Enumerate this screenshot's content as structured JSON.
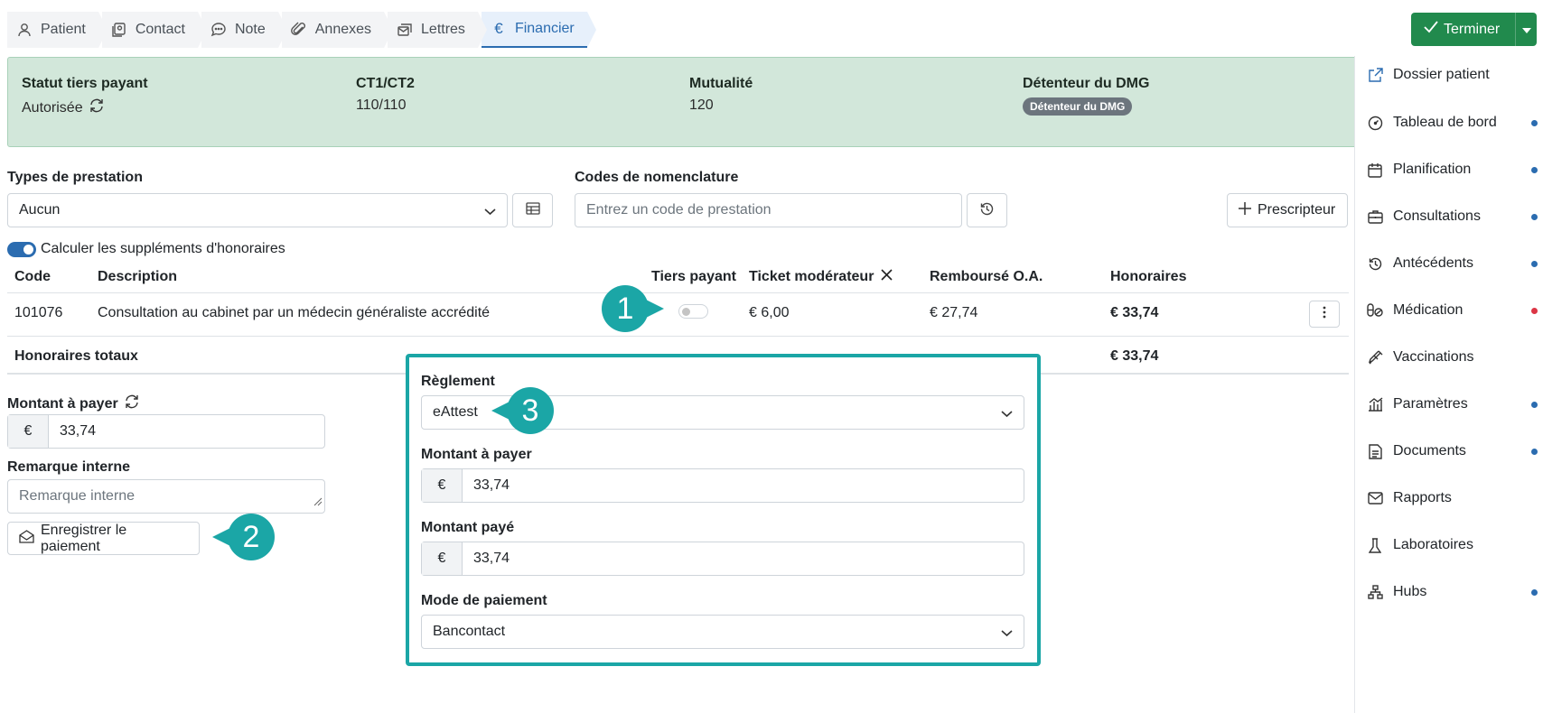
{
  "tabs": [
    {
      "label": "Patient",
      "icon": "user-icon"
    },
    {
      "label": "Contact",
      "icon": "contact-book-icon"
    },
    {
      "label": "Note",
      "icon": "chat-bubble-icon"
    },
    {
      "label": "Annexes",
      "icon": "paperclip-icon"
    },
    {
      "label": "Lettres",
      "icon": "envelopes-icon"
    },
    {
      "label": "Financier",
      "icon": "euro-icon",
      "active": true
    }
  ],
  "header": {
    "finish_label": "Terminer"
  },
  "status": {
    "tp_label": "Statut tiers payant",
    "tp_value": "Autorisée",
    "ct_label": "CT1/CT2",
    "ct_value": "110/110",
    "mut_label": "Mutualité",
    "mut_value": "120",
    "dmg_label": "Détenteur du DMG",
    "dmg_badge": "Détenteur du DMG"
  },
  "form": {
    "types_label": "Types de prestation",
    "types_value": "Aucun",
    "codes_label": "Codes de nomenclature",
    "codes_placeholder": "Entrez un code de prestation",
    "prescriber_label": "Prescripteur",
    "supplements_label": "Calculer les suppléments d'honoraires",
    "supplements_enabled": true
  },
  "table": {
    "headers": {
      "code": "Code",
      "description": "Description",
      "tp": "Tiers payant",
      "ticket": "Ticket modérateur",
      "rembourse": "Remboursé O.A.",
      "honoraires": "Honoraires"
    },
    "rows": [
      {
        "code": "101076",
        "description": "Consultation au cabinet par un médecin généraliste accrédité",
        "tiers_payant": false,
        "ticket": "€ 6,00",
        "rembourse": "€ 27,74",
        "honoraires": "€ 33,74"
      }
    ],
    "total_label": "Honoraires totaux",
    "total_value": "€ 33,74"
  },
  "payment_left": {
    "amount_label": "Montant à payer",
    "currency": "€",
    "amount_value": "33,74",
    "remark_label": "Remarque interne",
    "remark_placeholder": "Remarque interne",
    "save_label": "Enregistrer le paiement"
  },
  "payment_box": {
    "settlement_label": "Règlement",
    "settlement_value": "eAttest",
    "amount_label": "Montant à payer",
    "amount_value": "33,74",
    "paid_label": "Montant payé",
    "paid_value": "33,74",
    "mode_label": "Mode de paiement",
    "mode_value": "Bancontact",
    "currency": "€"
  },
  "callouts": [
    "1",
    "2",
    "3"
  ],
  "sidebar": [
    {
      "label": "Dossier patient",
      "icon": "external-link-icon",
      "dot": null
    },
    {
      "label": "Tableau de bord",
      "icon": "dashboard-icon",
      "dot": "#2b6cb0"
    },
    {
      "label": "Planification",
      "icon": "calendar-icon",
      "dot": "#2b6cb0"
    },
    {
      "label": "Consultations",
      "icon": "briefcase-icon",
      "dot": "#2b6cb0"
    },
    {
      "label": "Antécédents",
      "icon": "history-icon",
      "dot": "#2b6cb0"
    },
    {
      "label": "Médication",
      "icon": "pills-icon",
      "dot": "#dc3545"
    },
    {
      "label": "Vaccinations",
      "icon": "syringe-icon",
      "dot": null
    },
    {
      "label": "Paramètres",
      "icon": "bar-chart-icon",
      "dot": "#2b6cb0"
    },
    {
      "label": "Documents",
      "icon": "document-icon",
      "dot": "#2b6cb0"
    },
    {
      "label": "Rapports",
      "icon": "mail-icon",
      "dot": null
    },
    {
      "label": "Laboratoires",
      "icon": "flask-icon",
      "dot": null
    },
    {
      "label": "Hubs",
      "icon": "network-icon",
      "dot": "#2b6cb0"
    }
  ],
  "colors": {
    "accent": "#2b6cb0",
    "success": "#218a4d",
    "status_bg": "#d2e7da",
    "callout": "#1ba6a6"
  }
}
